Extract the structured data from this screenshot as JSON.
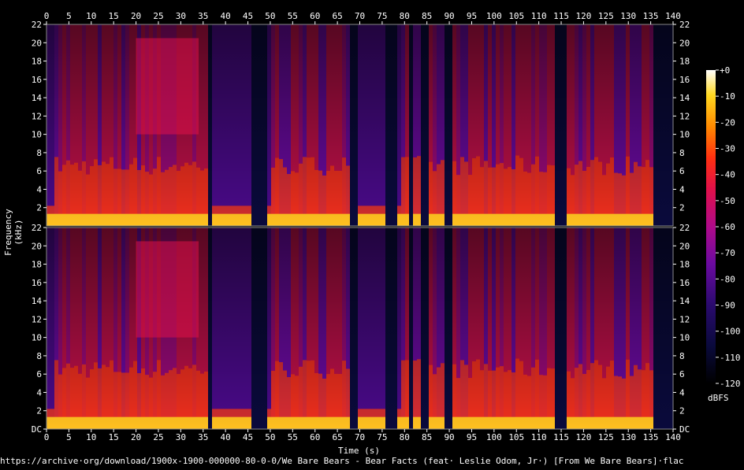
{
  "chart_data": {
    "type": "heatmap",
    "title": "",
    "xlabel": "Time (s)",
    "ylabel": "Frequency (kHz)",
    "xlim": [
      0,
      140
    ],
    "ylim_khz": [
      0,
      22
    ],
    "x_ticks": [
      "0",
      "5",
      "10",
      "15",
      "20",
      "25",
      "30",
      "35",
      "40",
      "45",
      "50",
      "55",
      "60",
      "65",
      "70",
      "75",
      "80",
      "85",
      "90",
      "95",
      "100",
      "105",
      "110",
      "115",
      "120",
      "125",
      "130",
      "135",
      "140"
    ],
    "y_ticks_top": [
      "2",
      "4",
      "6",
      "8",
      "10",
      "12",
      "14",
      "16",
      "18",
      "20",
      "22"
    ],
    "y_ticks_bottom": [
      "DC",
      "2",
      "4",
      "6",
      "8",
      "10",
      "12",
      "14",
      "16",
      "18",
      "20",
      "22"
    ],
    "channels": 2,
    "colorbar": {
      "unit": "dBFS",
      "ticks": [
        "+0",
        "-10",
        "-20",
        "-30",
        "-40",
        "-50",
        "-60",
        "-70",
        "-80",
        "-90",
        "-100",
        "-110",
        "-120"
      ],
      "range": [
        -120,
        0
      ]
    },
    "quiet_segments_s": [
      [
        36,
        37
      ],
      [
        46,
        49
      ],
      [
        68,
        70
      ],
      [
        76,
        78
      ],
      [
        81,
        82
      ],
      [
        84,
        85
      ],
      [
        89,
        91
      ],
      [
        114,
        116
      ],
      [
        136,
        140
      ]
    ],
    "loud_segments_s": [
      [
        2,
        36
      ],
      [
        50,
        68
      ],
      [
        79,
        89
      ],
      [
        91,
        114
      ],
      [
        116,
        136
      ]
    ],
    "source_url": "https://archive·org/download/1900x-1900-000000-80-0-0/We Bare Bears - Bear Facts (feat· Leslie Odom, Jr·) [From We Bare Bears]·flac"
  }
}
